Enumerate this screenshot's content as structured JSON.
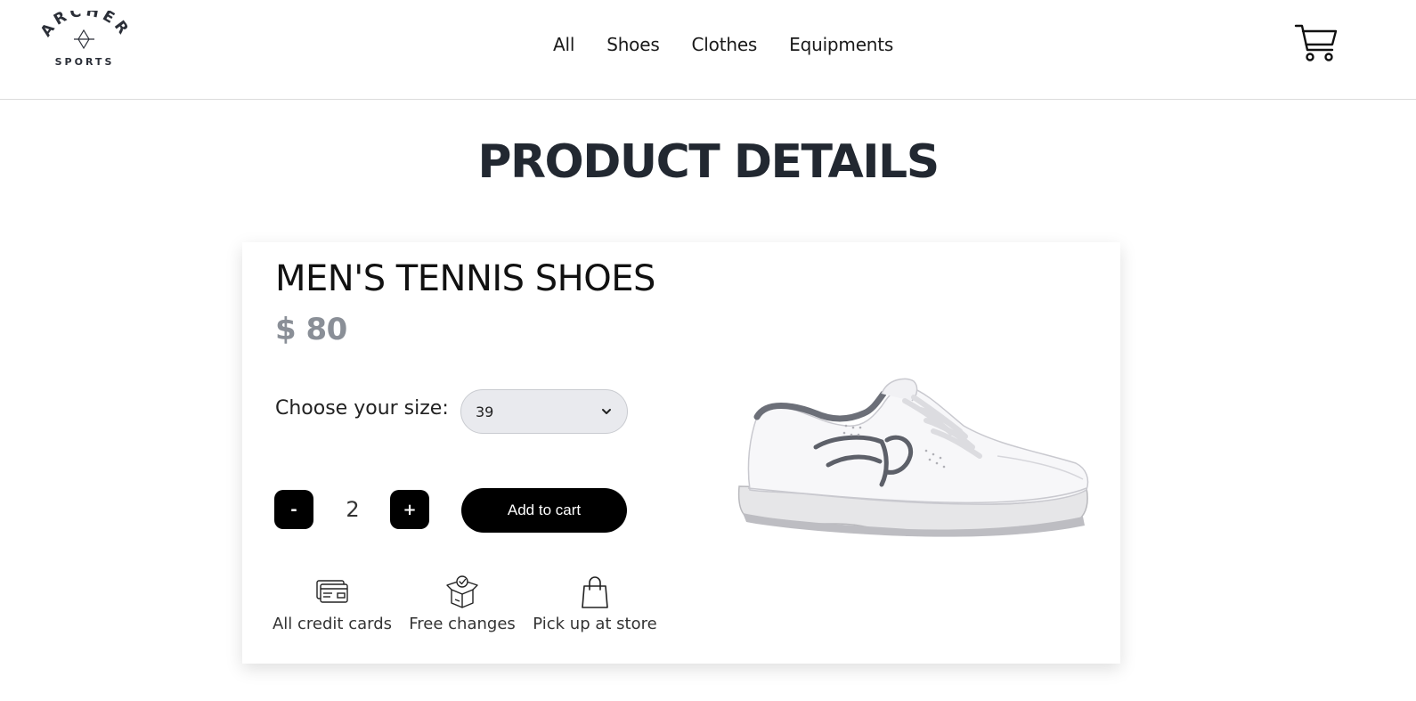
{
  "header": {
    "logo_text_top": "ARCHER",
    "logo_text_bottom": "SPORTS",
    "nav": [
      {
        "label": "All"
      },
      {
        "label": "Shoes"
      },
      {
        "label": "Clothes"
      },
      {
        "label": "Equipments"
      }
    ]
  },
  "page": {
    "title": "PRODUCT DETAILS"
  },
  "product": {
    "name": "MEN'S TENNIS SHOES",
    "price": "$ 80",
    "size_label": "Choose your size:",
    "size_selected": "39",
    "quantity": "2",
    "minus_label": "-",
    "plus_label": "+",
    "add_to_cart_label": "Add to cart",
    "features": [
      {
        "label": "All credit cards",
        "icon": "credit-card-icon"
      },
      {
        "label": "Free changes",
        "icon": "box-icon"
      },
      {
        "label": "Pick up at store",
        "icon": "shopping-bag-icon"
      }
    ]
  },
  "colors": {
    "title": "#222831",
    "price": "#8a8f97",
    "button_bg": "#000000",
    "select_bg": "#e9eaee"
  }
}
